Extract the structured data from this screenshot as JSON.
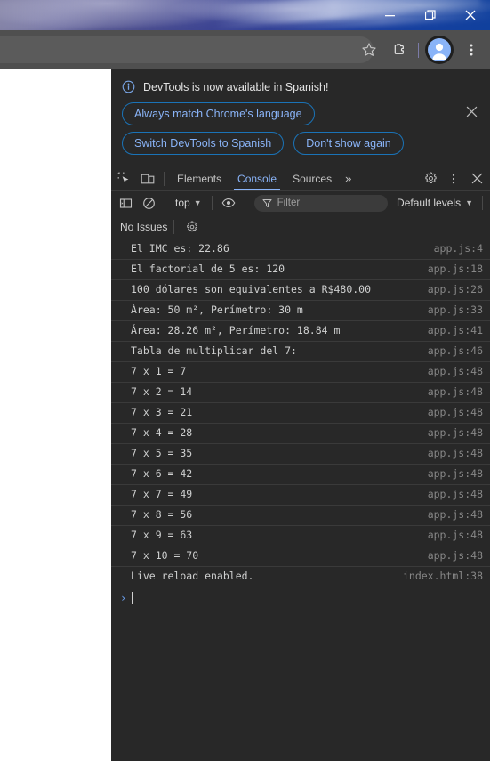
{
  "window": {
    "controls": [
      {
        "name": "minimize",
        "icon": "minimize-icon"
      },
      {
        "name": "restore",
        "icon": "restore-icon"
      },
      {
        "name": "close",
        "icon": "close-icon"
      }
    ]
  },
  "browser_toolbar": {
    "omnibox_value": "",
    "omnibox_placeholder": "",
    "actions": [
      {
        "name": "bookmark",
        "icon": "star-icon"
      },
      {
        "name": "extensions",
        "icon": "puzzle-icon"
      },
      {
        "name": "profile",
        "icon": "avatar-icon"
      },
      {
        "name": "menu",
        "icon": "three-dot-menu-icon"
      }
    ]
  },
  "devtools": {
    "banner": {
      "icon": "info-icon",
      "message": "DevTools is now available in Spanish!",
      "buttons": [
        "Always match Chrome's language",
        "Switch DevTools to Spanish",
        "Don't show again"
      ],
      "close_label": "×"
    },
    "tabbar": {
      "inspect_icon": "inspect-element-icon",
      "device_icon": "device-toolbar-icon",
      "tabs": [
        {
          "label": "Elements",
          "active": false
        },
        {
          "label": "Console",
          "active": true
        },
        {
          "label": "Sources",
          "active": false
        }
      ],
      "more_tabs": "»",
      "settings_icon": "gear-icon",
      "kebab_icon": "three-dot-menu-icon",
      "close_icon": "close-icon"
    },
    "console_toolbar": {
      "sidebar_icon": "console-sidebar-icon",
      "clear_icon": "clear-console-icon",
      "context": "top",
      "context_caret": "▼",
      "eye_icon": "live-expression-eye-icon",
      "filter_icon": "filter-icon",
      "filter_value": "",
      "filter_placeholder": "Filter",
      "levels_label": "Default levels",
      "levels_caret": "▼"
    },
    "issues_bar": {
      "label": "No Issues",
      "settings_icon": "gear-icon"
    },
    "logs": [
      {
        "message": "El IMC es: 22.86",
        "source": "app.js:4"
      },
      {
        "message": "El factorial de 5 es: 120",
        "source": "app.js:18"
      },
      {
        "message": "100 dólares son equivalentes a R$480.00",
        "source": "app.js:26"
      },
      {
        "message": "Área: 50 m², Perímetro: 30 m",
        "source": "app.js:33"
      },
      {
        "message": "Área: 28.26 m², Perímetro: 18.84 m",
        "source": "app.js:41"
      },
      {
        "message": "Tabla de multiplicar del 7:",
        "source": "app.js:46"
      },
      {
        "message": "7 x 1 = 7",
        "source": "app.js:48"
      },
      {
        "message": "7 x 2 = 14",
        "source": "app.js:48"
      },
      {
        "message": "7 x 3 = 21",
        "source": "app.js:48"
      },
      {
        "message": "7 x 4 = 28",
        "source": "app.js:48"
      },
      {
        "message": "7 x 5 = 35",
        "source": "app.js:48"
      },
      {
        "message": "7 x 6 = 42",
        "source": "app.js:48"
      },
      {
        "message": "7 x 7 = 49",
        "source": "app.js:48"
      },
      {
        "message": "7 x 8 = 56",
        "source": "app.js:48"
      },
      {
        "message": "7 x 9 = 63",
        "source": "app.js:48"
      },
      {
        "message": "7 x 10 = 70",
        "source": "app.js:48"
      },
      {
        "message": "Live reload enabled.",
        "source": "index.html:38"
      }
    ],
    "prompt": {
      "chevron": "›",
      "value": ""
    }
  },
  "colors": {
    "devtools_bg": "#282828",
    "toolbar_bg": "#4f4f4f",
    "accent_blue": "#8ab4f8",
    "log_text": "#cfd0d0",
    "source_text": "#878787",
    "theme_blue": "#1f3f9c",
    "theme_purple": "#4a4876"
  }
}
